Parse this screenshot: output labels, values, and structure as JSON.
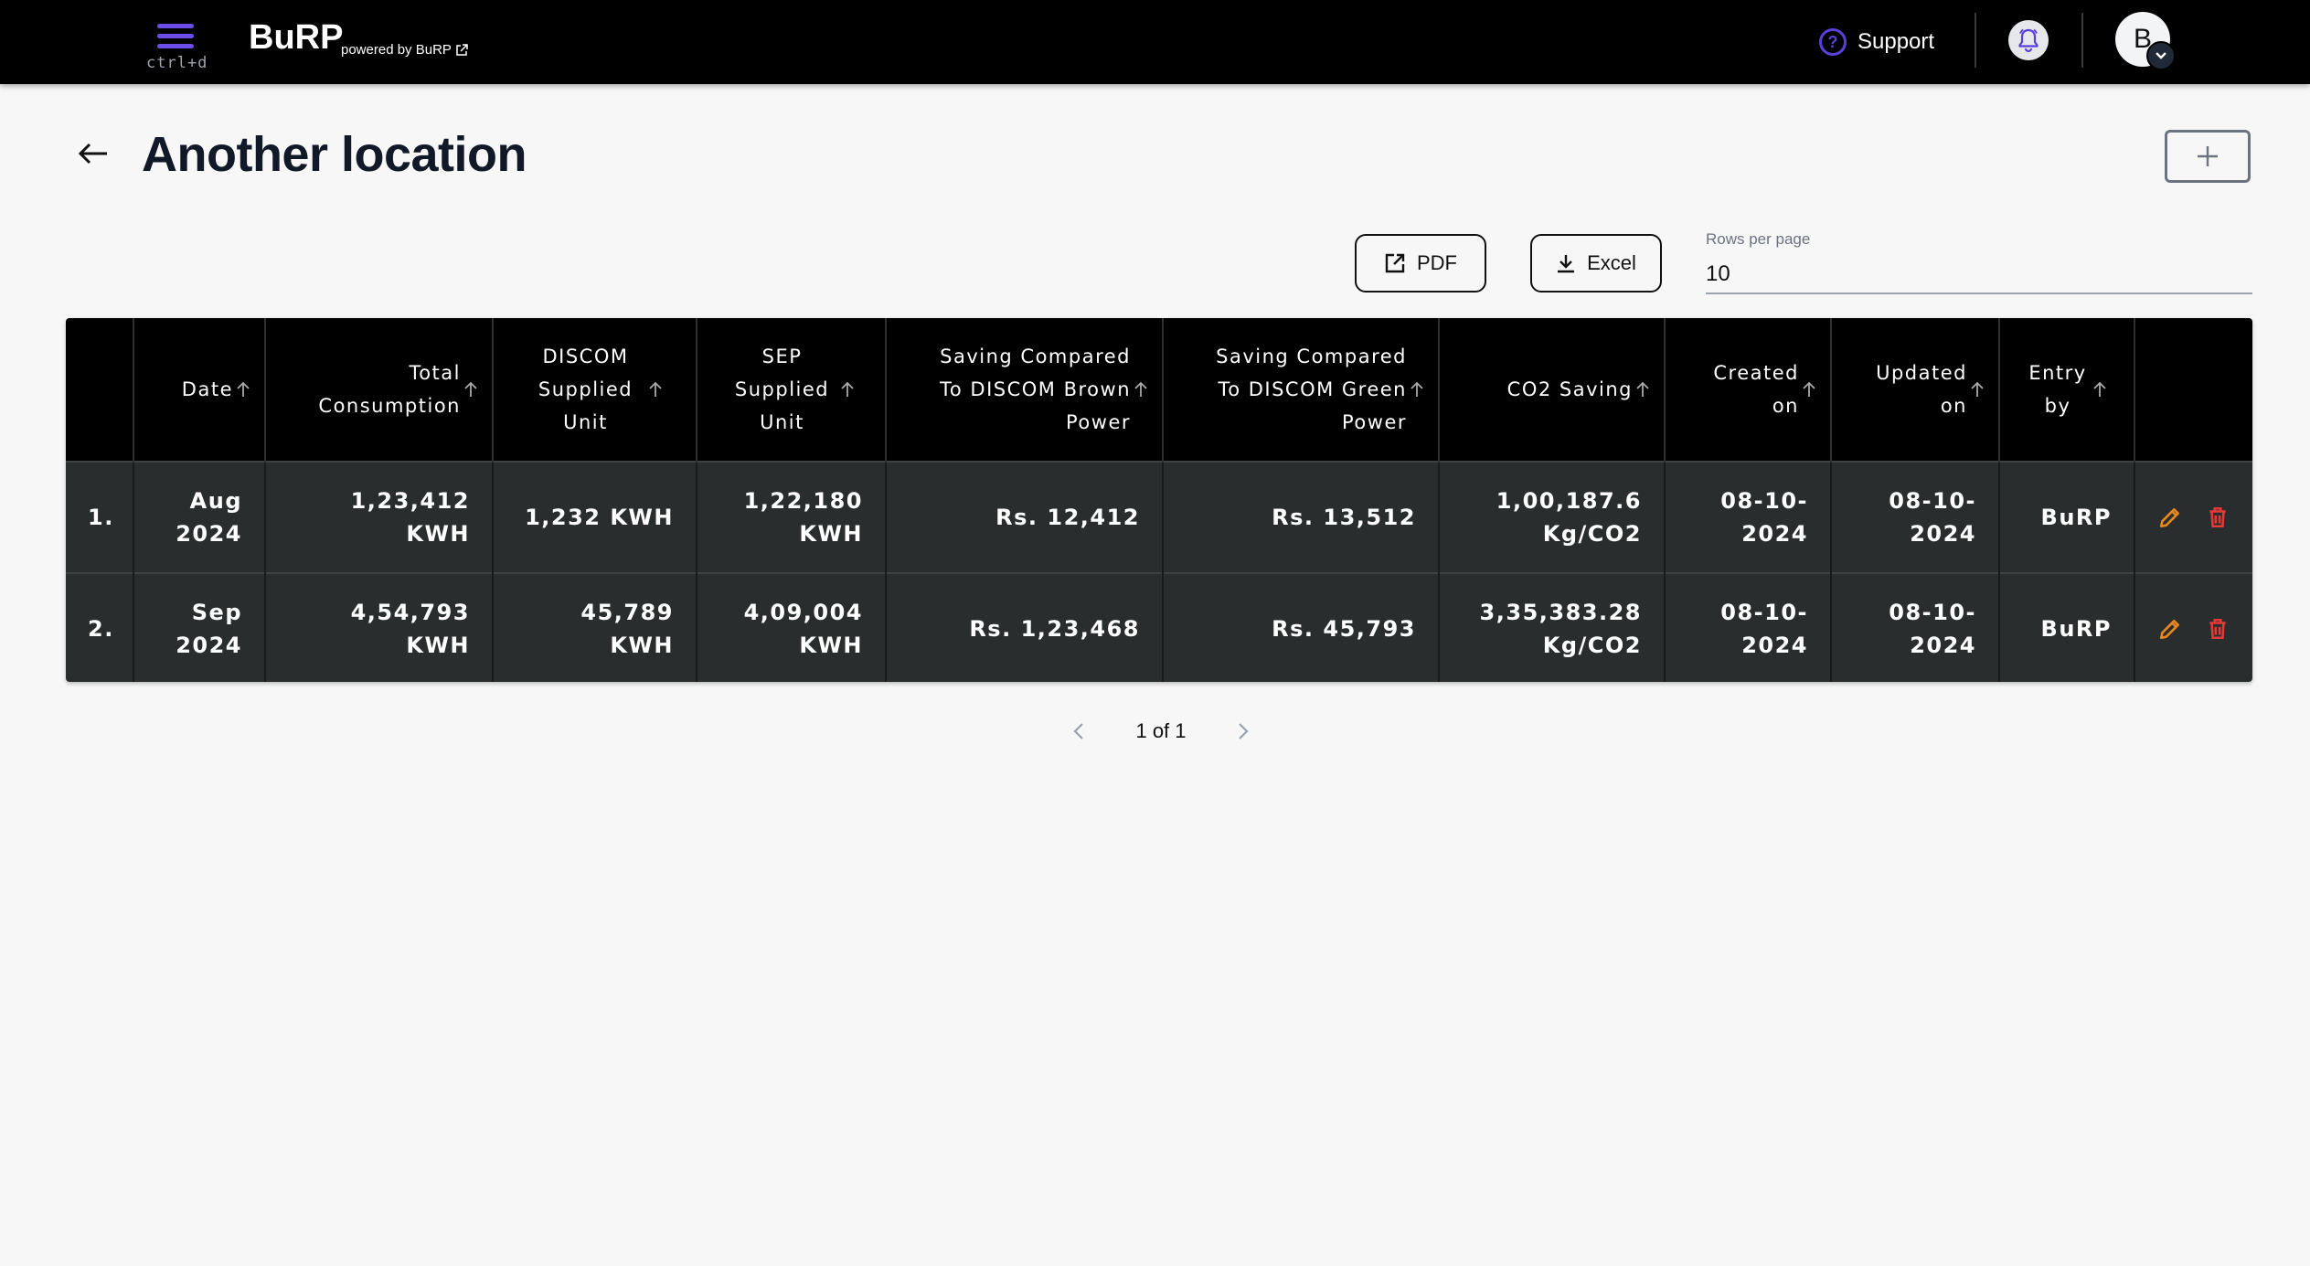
{
  "header": {
    "menu_hint": "ctrl+d",
    "brand": "BuRP",
    "powered_by": "powered by BuRP",
    "support_label": "Support",
    "avatar_initial": "B"
  },
  "page": {
    "title": "Another location"
  },
  "toolbar": {
    "pdf_label": "PDF",
    "excel_label": "Excel",
    "rows_per_page_label": "Rows per page",
    "rows_per_page_value": "10"
  },
  "table": {
    "columns": [
      {
        "label": "",
        "sortable": false
      },
      {
        "label": "Date",
        "sortable": true
      },
      {
        "label": "Total Consumption",
        "sortable": true
      },
      {
        "label": "DISCOM Supplied Unit",
        "sortable": true
      },
      {
        "label": "SEP Supplied Unit",
        "sortable": true
      },
      {
        "label": "Saving Compared To DISCOM Brown Power",
        "sortable": true
      },
      {
        "label": "Saving Compared To DISCOM Green Power",
        "sortable": true
      },
      {
        "label": "CO2 Saving",
        "sortable": true
      },
      {
        "label": "Created on",
        "sortable": true
      },
      {
        "label": "Updated on",
        "sortable": true
      },
      {
        "label": "Entry by",
        "sortable": true
      },
      {
        "label": "",
        "sortable": false
      }
    ],
    "rows": [
      {
        "index": "1.",
        "date": "Aug 2024",
        "total_consumption": "1,23,412 KWH",
        "discom_supplied": "1,232 KWH",
        "sep_supplied": "1,22,180 KWH",
        "saving_brown": "Rs. 12,412",
        "saving_green": "Rs. 13,512",
        "co2_saving": "1,00,187.6 Kg/CO2",
        "created_on": "08-10-2024",
        "updated_on": "08-10-2024",
        "entry_by": "BuRP"
      },
      {
        "index": "2.",
        "date": "Sep 2024",
        "total_consumption": "4,54,793 KWH",
        "discom_supplied": "45,789 KWH",
        "sep_supplied": "4,09,004 KWH",
        "saving_brown": "Rs. 1,23,468",
        "saving_green": "Rs. 45,793",
        "co2_saving": "3,35,383.28 Kg/CO2",
        "created_on": "08-10-2024",
        "updated_on": "08-10-2024",
        "entry_by": "BuRP"
      }
    ]
  },
  "pagination": {
    "label": "1 of 1"
  },
  "colors": {
    "accent": "#5b3fd9",
    "edit": "#e8871e",
    "delete": "#e53935",
    "header_bg": "#000000",
    "row_bg": "#2a2d2e"
  }
}
